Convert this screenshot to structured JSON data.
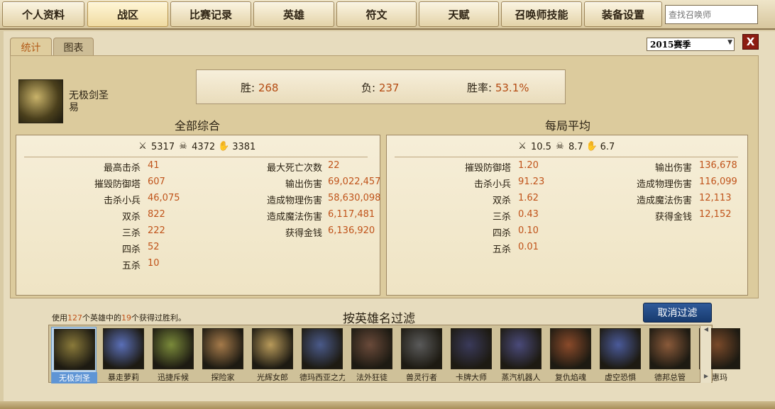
{
  "nav": {
    "tabs": [
      "个人资料",
      "战区",
      "比赛记录",
      "英雄",
      "符文",
      "天赋",
      "召唤师技能",
      "装备设置"
    ],
    "active_index": 1,
    "search_placeholder": "查找召唤师"
  },
  "subtabs": {
    "stats": "统计",
    "chart": "图表"
  },
  "season": {
    "selected": "2015赛季"
  },
  "close_label": "X",
  "hero": {
    "name": "无极剑圣",
    "alt": "易"
  },
  "record": {
    "wins_label": "胜:",
    "wins": "268",
    "losses_label": "负:",
    "losses": "237",
    "winrate_label": "胜率:",
    "winrate": "53.1%"
  },
  "total": {
    "title": "全部综合",
    "kills": "5317",
    "deaths": "4372",
    "assists": "3381",
    "left": [
      {
        "label": "最高击杀",
        "value": "41"
      },
      {
        "label": "摧毁防御塔",
        "value": "607"
      },
      {
        "label": "击杀小兵",
        "value": "46,075"
      },
      {
        "label": "双杀",
        "value": "822"
      },
      {
        "label": "三杀",
        "value": "222"
      },
      {
        "label": "四杀",
        "value": "52"
      },
      {
        "label": "五杀",
        "value": "10"
      }
    ],
    "right": [
      {
        "label": "最大死亡次数",
        "value": "22"
      },
      {
        "label": "输出伤害",
        "value": "69,022,457"
      },
      {
        "label": "造成物理伤害",
        "value": "58,630,098"
      },
      {
        "label": "造成魔法伤害",
        "value": "6,117,481"
      },
      {
        "label": "获得金钱",
        "value": "6,136,920"
      }
    ]
  },
  "average": {
    "title": "每局平均",
    "kills": "10.5",
    "deaths": "8.7",
    "assists": "6.7",
    "left": [
      {
        "label": "摧毁防御塔",
        "value": "1.20"
      },
      {
        "label": "击杀小兵",
        "value": "91.23"
      },
      {
        "label": "双杀",
        "value": "1.62"
      },
      {
        "label": "三杀",
        "value": "0.43"
      },
      {
        "label": "四杀",
        "value": "0.10"
      },
      {
        "label": "五杀",
        "value": "0.01"
      }
    ],
    "right": [
      {
        "label": "输出伤害",
        "value": "136,678"
      },
      {
        "label": "造成物理伤害",
        "value": "116,099"
      },
      {
        "label": "造成魔法伤害",
        "value": "12,113"
      },
      {
        "label": "获得金钱",
        "value": "12,152"
      }
    ]
  },
  "filter": {
    "win_prefix": "使用",
    "hero_count": "127",
    "win_mid": "个英雄中的",
    "won_count": "19",
    "win_suffix": "个获得过胜利。",
    "title": "按英雄名过滤",
    "clear_label": "取消过滤"
  },
  "champions": [
    {
      "name": "无极剑圣",
      "color": "#8a7a3a"
    },
    {
      "name": "暴走萝莉",
      "color": "#5a6fb8"
    },
    {
      "name": "迅捷斥候",
      "color": "#7a8a3a"
    },
    {
      "name": "探险家",
      "color": "#a57a4a"
    },
    {
      "name": "光辉女郎",
      "color": "#b89a5a"
    },
    {
      "name": "德玛西亚之力",
      "color": "#4a5a8a"
    },
    {
      "name": "法外狂徒",
      "color": "#6a4a3a"
    },
    {
      "name": "兽灵行者",
      "color": "#5a5a5a"
    },
    {
      "name": "卡牌大师",
      "color": "#3a3a5a"
    },
    {
      "name": "蒸汽机器人",
      "color": "#4a4a7a"
    },
    {
      "name": "复仇焰魂",
      "color": "#8a4a2a"
    },
    {
      "name": "虚空恐惧",
      "color": "#4a5a9a"
    },
    {
      "name": "德邦总管",
      "color": "#8a5a3a"
    },
    {
      "name": "惠玛",
      "color": "#7a4a2a"
    }
  ]
}
